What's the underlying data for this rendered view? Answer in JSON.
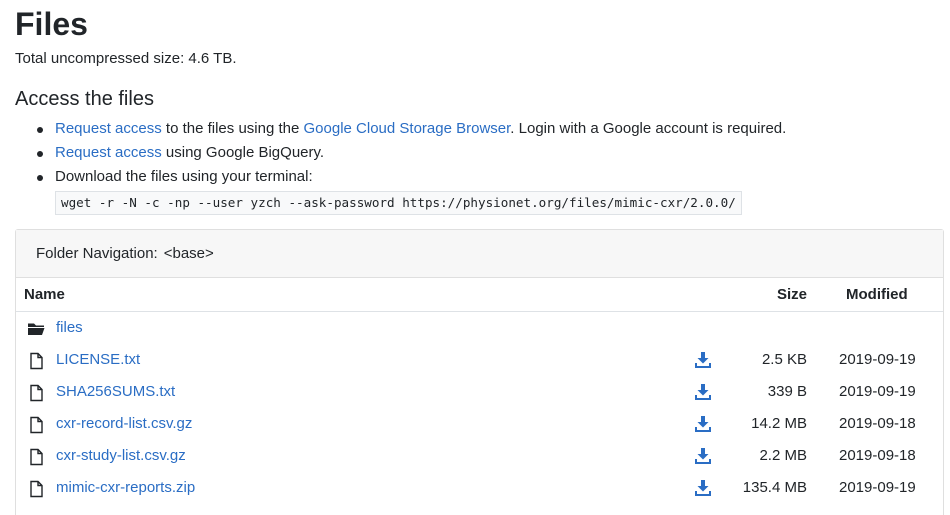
{
  "title": "Files",
  "size_line": "Total uncompressed size: 4.6 TB.",
  "access": {
    "heading": "Access the files",
    "items": [
      {
        "link": "Request access",
        "mid": " to the files using the ",
        "link2": "Google Cloud Storage Browser",
        "tail": ". Login with a Google account is required."
      },
      {
        "link": "Request access",
        "tail": " using Google BigQuery."
      },
      {
        "text": "Download the files using your terminal:",
        "command": "wget -r -N -c -np --user yzch --ask-password https://physionet.org/files/mimic-cxr/2.0.0/"
      }
    ]
  },
  "browser": {
    "nav_label": "Folder Navigation:",
    "nav_base": "<base>",
    "headers": {
      "name": "Name",
      "size": "Size",
      "modified": "Modified"
    },
    "folder": {
      "name": "files",
      "icon": "folder-icon"
    },
    "files": [
      {
        "name": "LICENSE.txt",
        "size": "2.5 KB",
        "modified": "2019-09-19"
      },
      {
        "name": "SHA256SUMS.txt",
        "size": "339 B",
        "modified": "2019-09-19"
      },
      {
        "name": "cxr-record-list.csv.gz",
        "size": "14.2 MB",
        "modified": "2019-09-18"
      },
      {
        "name": "cxr-study-list.csv.gz",
        "size": "2.2 MB",
        "modified": "2019-09-18"
      },
      {
        "name": "mimic-cxr-reports.zip",
        "size": "135.4 MB",
        "modified": "2019-09-19"
      }
    ]
  },
  "colors": {
    "link": "#2a6dc4",
    "text": "#212529"
  },
  "icons": {
    "file": "file-icon",
    "download": "download-icon",
    "folder": "folder-icon"
  }
}
